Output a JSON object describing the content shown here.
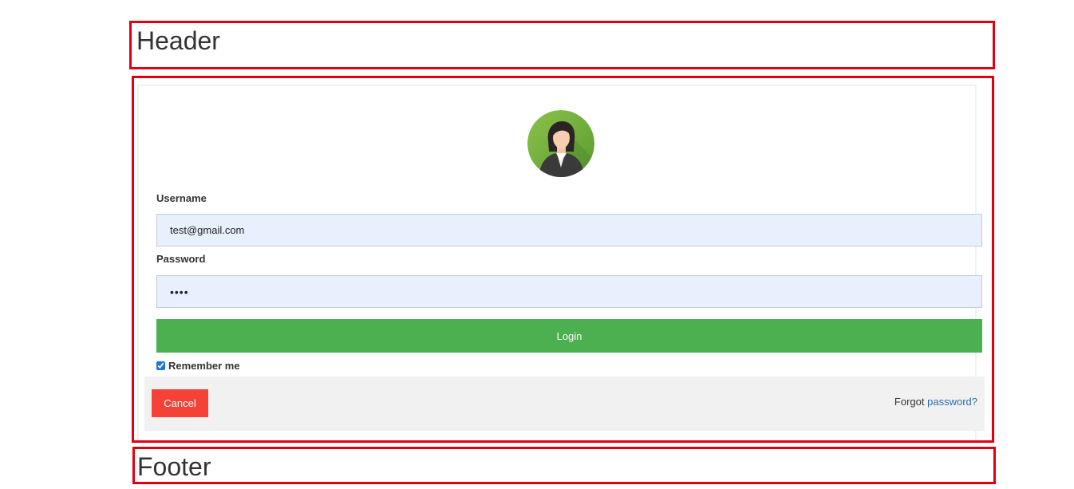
{
  "header": {
    "title": "Header"
  },
  "form": {
    "username_label": "Username",
    "username_value": "test@gmail.com",
    "password_label": "Password",
    "password_value": "••••",
    "login_label": "Login",
    "remember_label": "Remember me",
    "remember_checked": true,
    "cancel_label": "Cancel",
    "forgot_prefix": "Forgot",
    "forgot_link": "password?",
    "avatar_icon": "user-avatar-icon"
  },
  "footer": {
    "title": "Footer"
  },
  "colors": {
    "outline": "#e0000f",
    "login_button": "#4caf50",
    "cancel_button": "#f44336",
    "input_bg": "#e8f0fe",
    "link": "#2a6eb5",
    "footer_bar": "#f1f1f1"
  }
}
